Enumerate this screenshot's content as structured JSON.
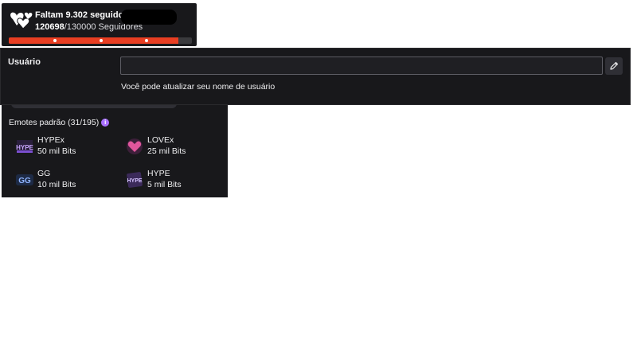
{
  "goal": {
    "title": "Faltam 9.302 seguidores!",
    "current": "120698",
    "target": "/130000 Seguidores",
    "progress_fraction": 0.928,
    "bar_color": "#e83e22"
  },
  "user_setting": {
    "label": "Usuário",
    "input_value": "",
    "hint": "Você pode atualizar seu nome de usuário",
    "edit_icon": "pencil-icon"
  },
  "emotes": {
    "header": "Emotes padrão (31/195)",
    "info_icon": "info-icon",
    "items": [
      {
        "name": "HYPEx",
        "cost": "50 mil Bits"
      },
      {
        "name": "LOVEx",
        "cost": "25 mil Bits"
      },
      {
        "name": "GG",
        "cost": "10 mil Bits"
      },
      {
        "name": "HYPE",
        "cost": "5 mil Bits"
      }
    ]
  }
}
